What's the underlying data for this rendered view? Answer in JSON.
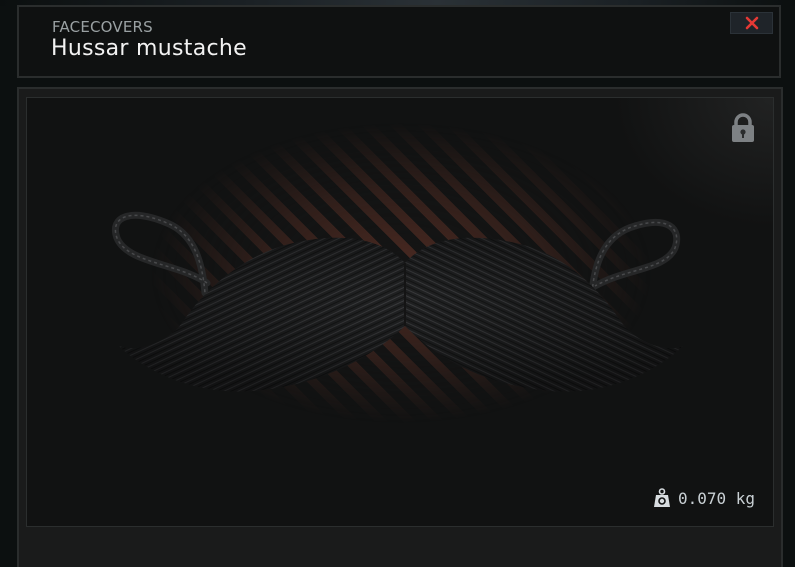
{
  "header": {
    "category": "FACECOVERS",
    "title": "Hussar mustache"
  },
  "close_button": {
    "icon": "close-icon",
    "color": "#e53935"
  },
  "preview": {
    "item_image": "hussar-mustache",
    "locked_icon": "padlock-icon",
    "weight": {
      "icon": "weight-icon",
      "value": "0.070 kg"
    }
  }
}
